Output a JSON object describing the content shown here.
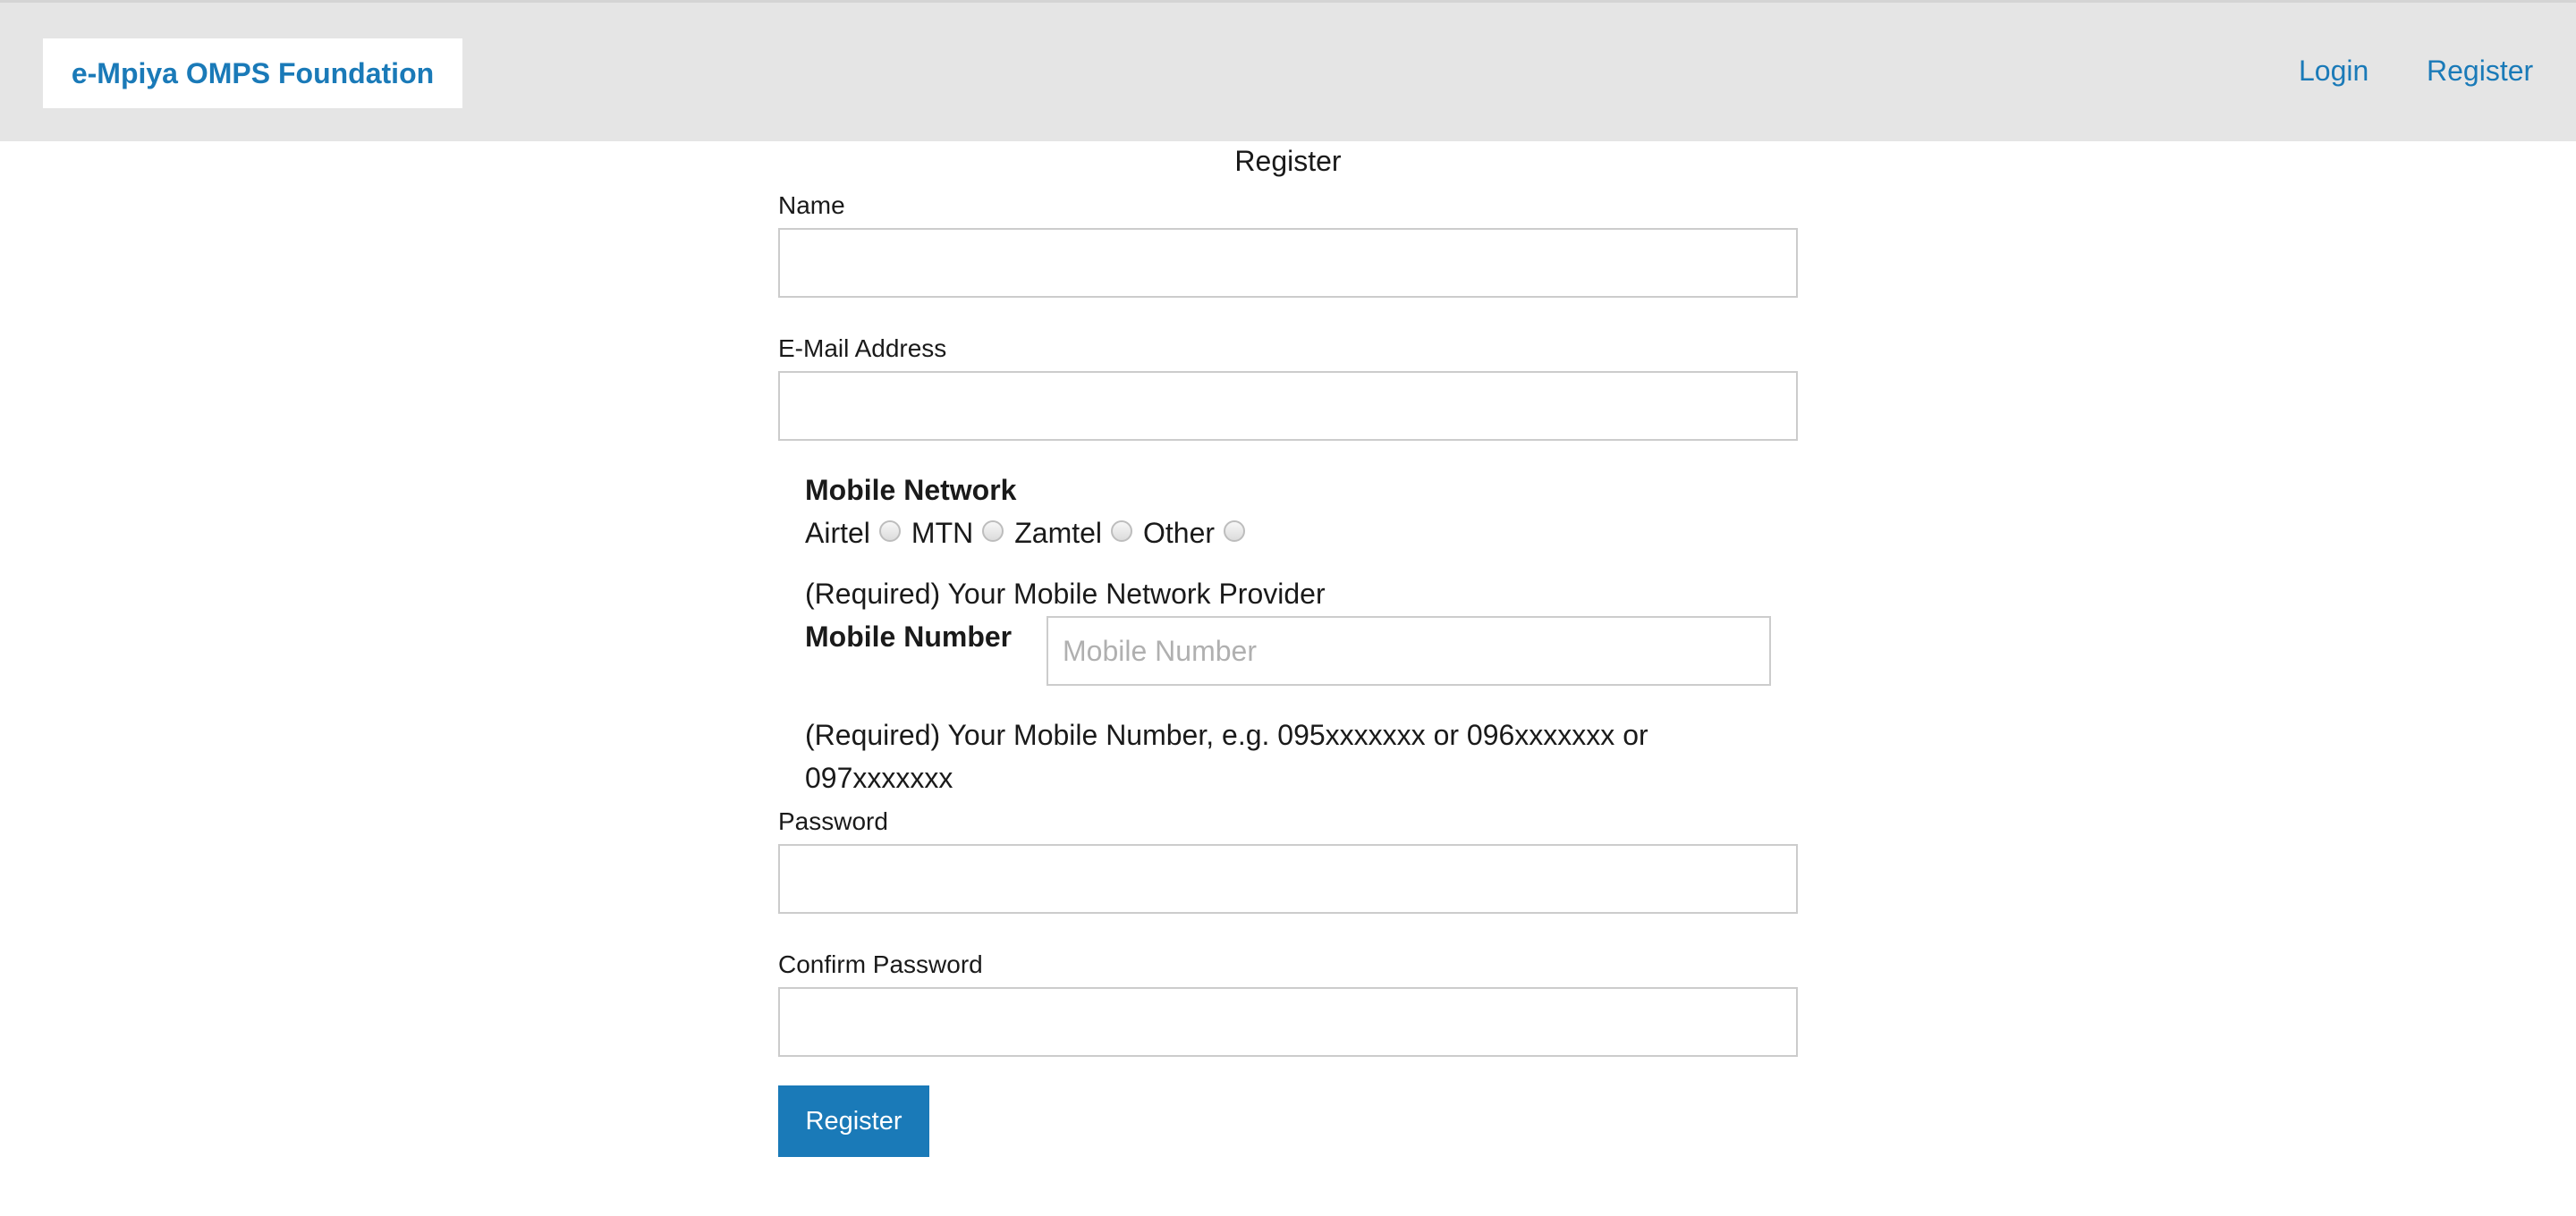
{
  "header": {
    "brand": "e-Mpiya OMPS Foundation",
    "nav": {
      "login": "Login",
      "register": "Register"
    }
  },
  "form": {
    "title": "Register",
    "name_label": "Name",
    "name_value": "",
    "email_label": "E-Mail Address",
    "email_value": "",
    "mobile_network": {
      "heading": "Mobile Network",
      "options": [
        "Airtel",
        "MTN",
        "Zamtel",
        "Other"
      ],
      "selected": null,
      "help": "(Required) Your Mobile Network Provider"
    },
    "mobile_number": {
      "label": "Mobile Number",
      "placeholder": "Mobile Number",
      "value": "",
      "help_line1": "(Required) Your Mobile Number, e.g. 095xxxxxxx or 096xxxxxxx or",
      "help_line2": "097xxxxxxx"
    },
    "password_label": "Password",
    "password_value": "",
    "confirm_password_label": "Confirm Password",
    "confirm_password_value": "",
    "submit_label": "Register"
  },
  "colors": {
    "brand": "#1a7ab8",
    "header_bg": "#e5e5e5",
    "button_bg": "#1a7ab8"
  }
}
